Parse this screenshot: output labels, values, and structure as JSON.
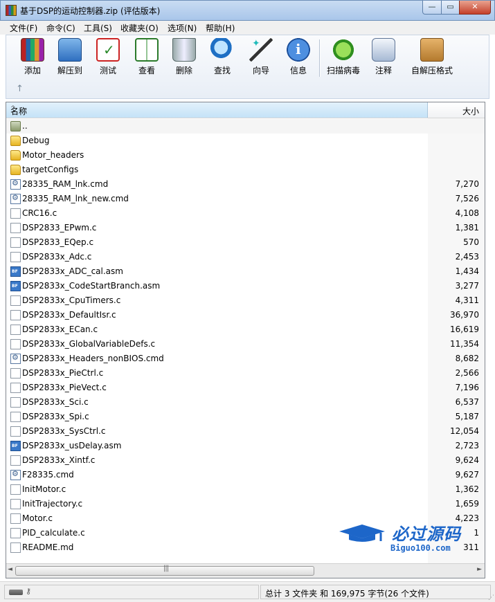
{
  "window": {
    "title": "基于DSP的运动控制器.zip (评估版本)",
    "minimize": "—",
    "maximize": "▭",
    "close": "✕"
  },
  "menu": [
    "文件(F)",
    "命令(C)",
    "工具(S)",
    "收藏夹(O)",
    "选项(N)",
    "帮助(H)"
  ],
  "toolbar": {
    "add": "添加",
    "extract": "解压到",
    "test": "测试",
    "view": "查看",
    "delete": "删除",
    "find": "查找",
    "wizard": "向导",
    "info": "信息",
    "virus_scan": "扫描病毒",
    "comment": "注释",
    "sfx": "自解压格式",
    "up_arrow": "↑"
  },
  "columns": {
    "name": "名称",
    "size": "大小",
    "sort_indicator": "^"
  },
  "files": [
    {
      "name": "..",
      "size": "",
      "type": "parent"
    },
    {
      "name": "Debug",
      "size": "",
      "type": "folder"
    },
    {
      "name": "Motor_headers",
      "size": "",
      "type": "folder"
    },
    {
      "name": "targetConfigs",
      "size": "",
      "type": "folder"
    },
    {
      "name": "28335_RAM_lnk.cmd",
      "size": "7,270",
      "type": "cmd"
    },
    {
      "name": "28335_RAM_lnk_new.cmd",
      "size": "7,526",
      "type": "cmd"
    },
    {
      "name": "CRC16.c",
      "size": "4,108",
      "type": "file"
    },
    {
      "name": "DSP2833_EPwm.c",
      "size": "1,381",
      "type": "file"
    },
    {
      "name": "DSP2833_EQep.c",
      "size": "570",
      "type": "file"
    },
    {
      "name": "DSP2833x_Adc.c",
      "size": "2,453",
      "type": "file"
    },
    {
      "name": "DSP2833x_ADC_cal.asm",
      "size": "1,434",
      "type": "asm"
    },
    {
      "name": "DSP2833x_CodeStartBranch.asm",
      "size": "3,277",
      "type": "asm"
    },
    {
      "name": "DSP2833x_CpuTimers.c",
      "size": "4,311",
      "type": "file"
    },
    {
      "name": "DSP2833x_DefaultIsr.c",
      "size": "36,970",
      "type": "file"
    },
    {
      "name": "DSP2833x_ECan.c",
      "size": "16,619",
      "type": "file"
    },
    {
      "name": "DSP2833x_GlobalVariableDefs.c",
      "size": "11,354",
      "type": "file"
    },
    {
      "name": "DSP2833x_Headers_nonBIOS.cmd",
      "size": "8,682",
      "type": "cmd"
    },
    {
      "name": "DSP2833x_PieCtrl.c",
      "size": "2,566",
      "type": "file"
    },
    {
      "name": "DSP2833x_PieVect.c",
      "size": "7,196",
      "type": "file"
    },
    {
      "name": "DSP2833x_Sci.c",
      "size": "6,537",
      "type": "file"
    },
    {
      "name": "DSP2833x_Spi.c",
      "size": "5,187",
      "type": "file"
    },
    {
      "name": "DSP2833x_SysCtrl.c",
      "size": "12,054",
      "type": "file"
    },
    {
      "name": "DSP2833x_usDelay.asm",
      "size": "2,723",
      "type": "asm"
    },
    {
      "name": "DSP2833x_Xintf.c",
      "size": "9,624",
      "type": "file"
    },
    {
      "name": "F28335.cmd",
      "size": "9,627",
      "type": "cmd"
    },
    {
      "name": "InitMotor.c",
      "size": "1,362",
      "type": "file"
    },
    {
      "name": "InitTrajectory.c",
      "size": "1,659",
      "type": "file"
    },
    {
      "name": "Motor.c",
      "size": "4,223",
      "type": "file"
    },
    {
      "name": "PID_calculate.c",
      "size": "1",
      "type": "file"
    },
    {
      "name": "README.md",
      "size": "311",
      "type": "file"
    }
  ],
  "scrollbar": {
    "left": "◄",
    "right": "►",
    "grip": "|||"
  },
  "watermark": {
    "text_cn": "必过源码",
    "text_en": "Biguo100.com"
  },
  "statusbar": {
    "key_icon": "⚷",
    "summary": "总计 3 文件夹 和 169,975 字节(26 个文件)",
    "grip": "⋰"
  },
  "colors": {
    "titlebar": "#b9d1ee",
    "selection_header": "#c4e2f7",
    "watermark_blue": "#1d66c9"
  }
}
